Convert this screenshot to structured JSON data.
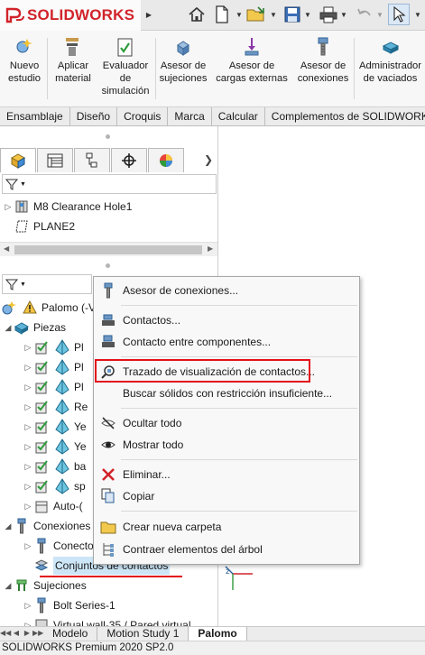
{
  "app": {
    "name": "SOLIDWORKS",
    "colors": {
      "brand": "#d1232a",
      "highlight": "#e3111a",
      "selection": "#cde6f7"
    }
  },
  "ribbon": {
    "buttons": [
      {
        "label": "Nuevo estudio",
        "icon": "new-study-icon"
      },
      {
        "label": "Aplicar material",
        "icon": "apply-material-icon"
      },
      {
        "label": "Evaluador de simulación",
        "icon": "simulation-evaluator-icon"
      },
      {
        "label": "Asesor de sujeciones",
        "icon": "fixtures-advisor-icon"
      },
      {
        "label": "Asesor de cargas externas",
        "icon": "external-loads-advisor-icon"
      },
      {
        "label": "Asesor de conexiones",
        "icon": "connections-advisor-icon"
      },
      {
        "label": "Administrador de vaciados",
        "icon": "shell-manager-icon"
      }
    ]
  },
  "command_tabs": [
    "Ensamblaje",
    "Diseño",
    "Croquis",
    "Marca",
    "Calcular",
    "Complementos de SOLIDWORKS"
  ],
  "feature_tree": {
    "items": [
      "M8 Clearance Hole1",
      "PLANE2"
    ]
  },
  "sim_tree": {
    "root": "Palomo (-Valor predeterminado-)",
    "pieces_label": "Piezas",
    "pieces": [
      "Pl",
      "Pl",
      "Pl",
      "Re",
      "Ye",
      "Ye",
      "ba",
      "sp"
    ],
    "auto_label": "Auto-(",
    "connections_label": "Conexiones",
    "connector_item": "Conectores",
    "contact_sets": "Conjuntos de contactos",
    "fixtures_label": "Sujeciones",
    "bolt_item": "Bolt Series-1",
    "virtual_wall": "Virtual wall-35 / Pared virtual"
  },
  "context_menu": {
    "items": [
      {
        "label": "Asesor de conexiones...",
        "icon": "connections-advisor-icon"
      },
      {
        "label": "Contactos...",
        "icon": "contacts-icon"
      },
      {
        "label": "Contacto entre componentes...",
        "icon": "component-contact-icon"
      },
      {
        "label": "Trazado de visualización de contactos...",
        "icon": "contact-visualization-icon"
      },
      {
        "label": "Buscar sólidos con restricción insuficiente...",
        "icon": ""
      },
      {
        "label": "Ocultar todo",
        "icon": "hide-all-icon"
      },
      {
        "label": "Mostrar todo",
        "icon": "show-all-icon"
      },
      {
        "label": "Eliminar...",
        "icon": "delete-icon"
      },
      {
        "label": "Copiar",
        "icon": "copy-icon"
      },
      {
        "label": "Crear nueva carpeta",
        "icon": "new-folder-icon"
      },
      {
        "label": "Contraer elementos del árbol",
        "icon": "collapse-tree-icon"
      }
    ]
  },
  "bottom_tabs": [
    "Modelo",
    "Motion Study 1",
    "Palomo"
  ],
  "status_bar": "SOLIDWORKS Premium 2020 SP2.0"
}
